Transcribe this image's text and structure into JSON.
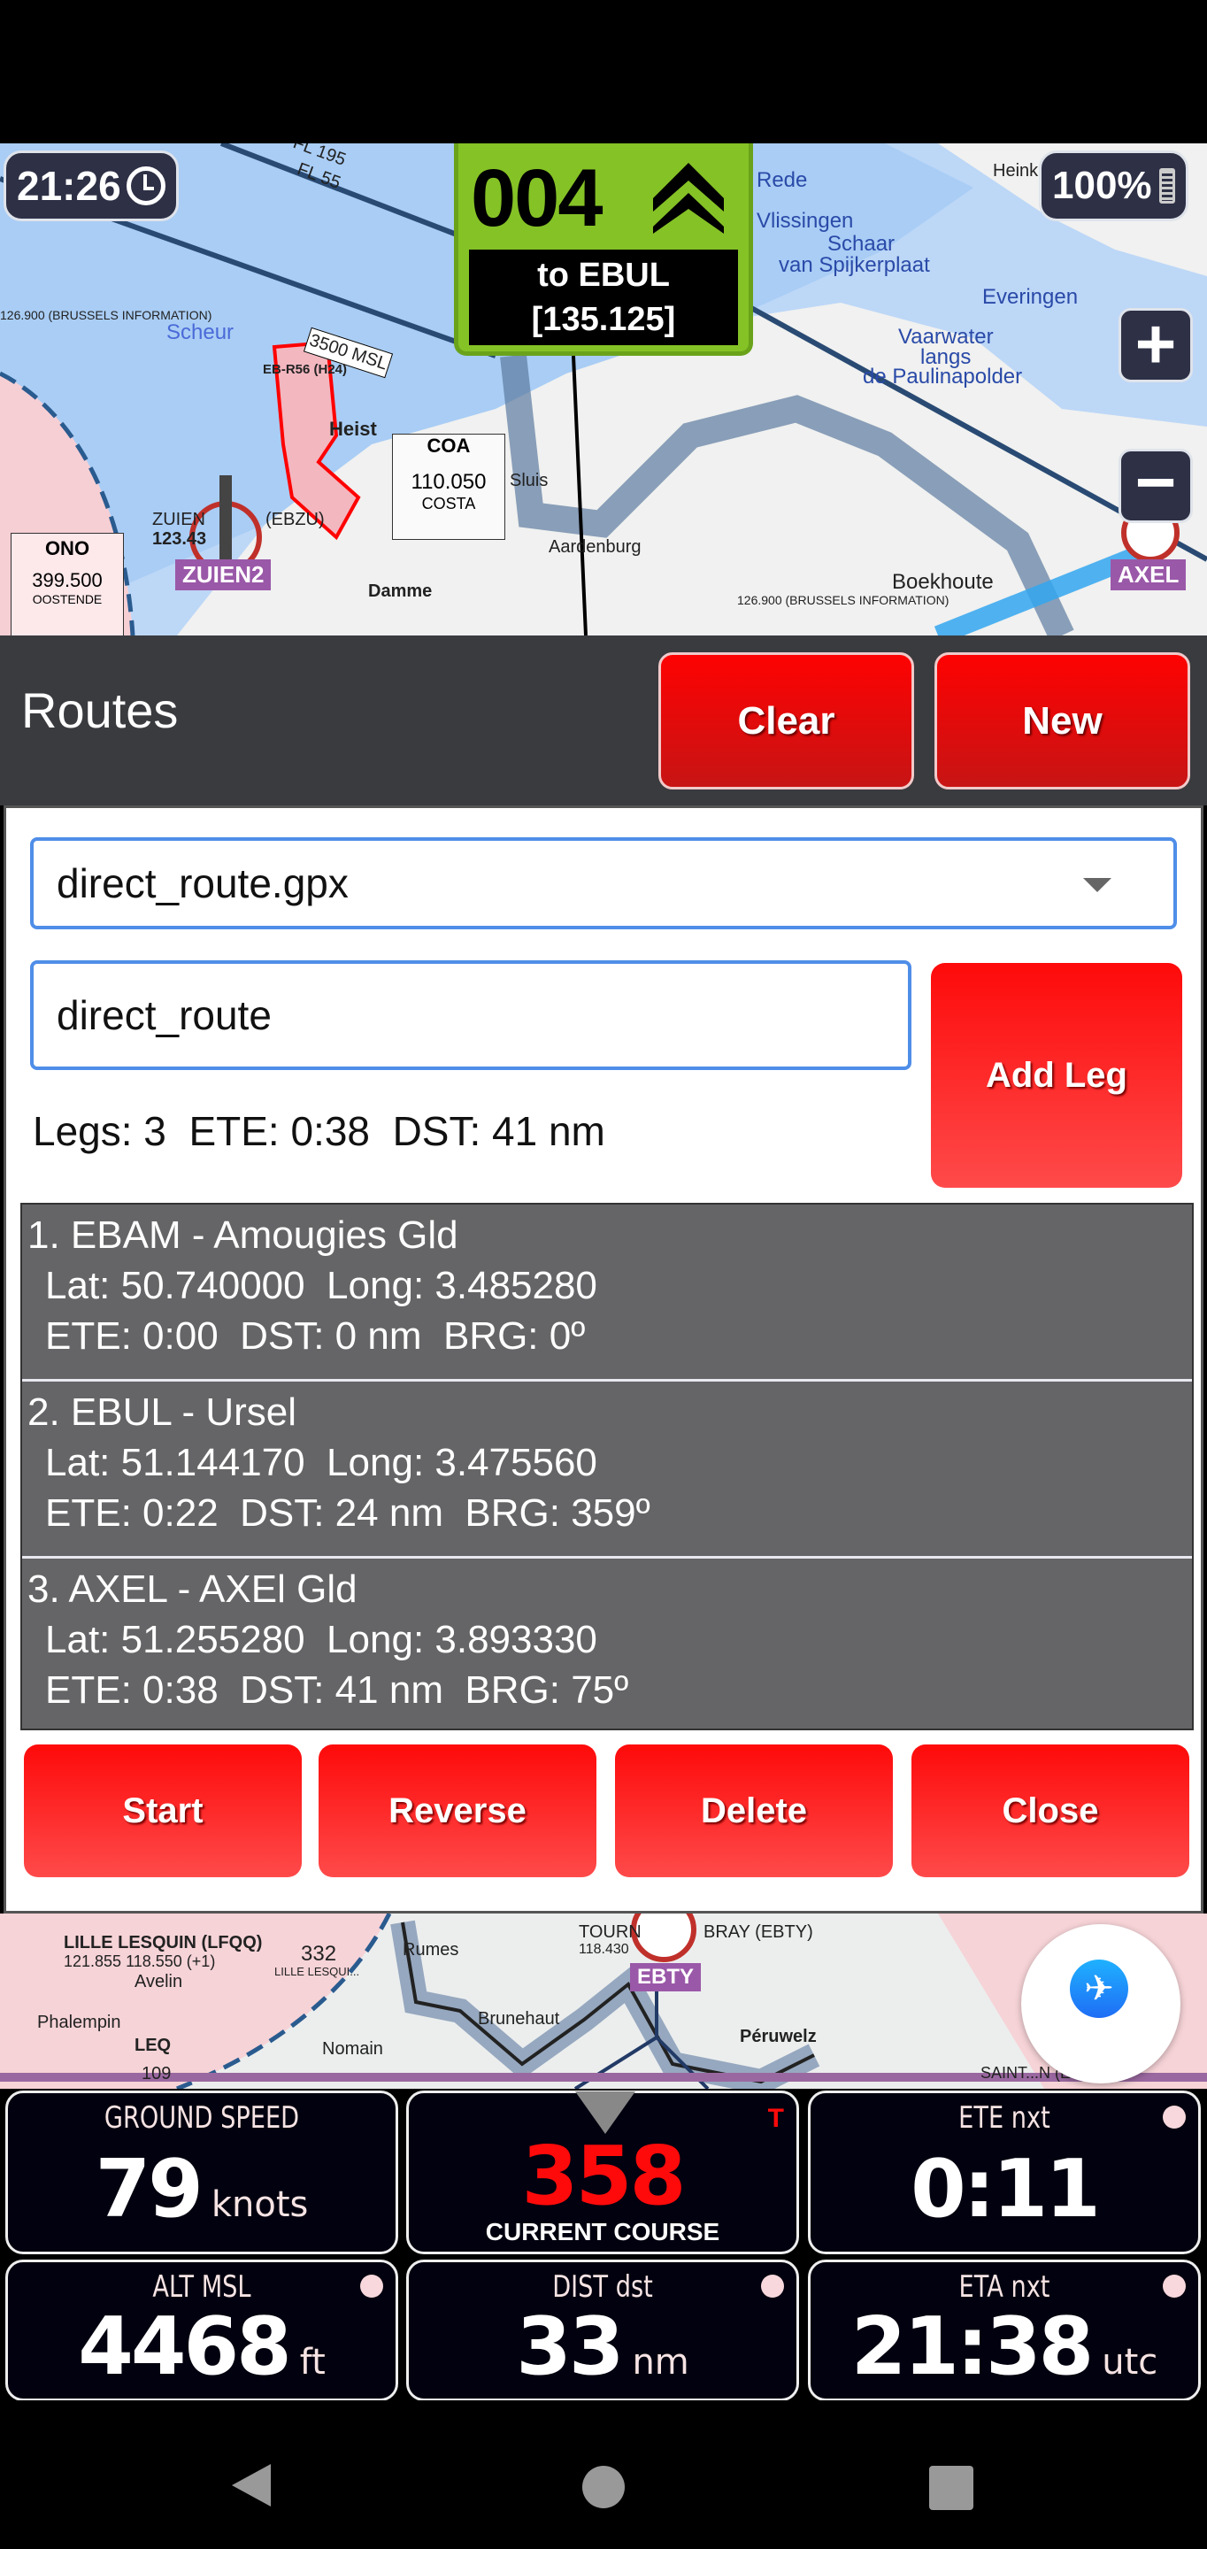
{
  "status": {
    "clock": "21:26",
    "battery": "100%"
  },
  "heading": {
    "value": "004",
    "target": "to EBUL",
    "frequency": "[135.125]",
    "color": "#85c226"
  },
  "map_labels": {
    "top": [
      "FL 195",
      "FL 55",
      "Scheur",
      "3500 MSL",
      "126.900 (BRUSSELS INFORMATION)",
      "EB-R56 (H24)",
      "Heist",
      "COA",
      "110.050",
      "COSTA",
      "Sluis",
      "Aardenburg",
      "Damme",
      "ONO",
      "399.500",
      "OOSTENDE",
      "ZUIEN",
      "123.43",
      "(EBZU)",
      "Rede",
      "Vlissingen",
      "Schaar",
      "van Spijkerplaat",
      "Everingen",
      "Vaarwater",
      "langs",
      "de Paulinapolder",
      "Heinkenszand",
      "Boekhoute",
      "126.900 (BRUSSELS INFORMATION)"
    ],
    "bottom": [
      "LILLE LESQUIN (LFQQ)",
      "121.855 118.550 (+1)",
      "332",
      "LILLE LESQUI...",
      "Avelin",
      "Phalempin",
      "LEQ",
      "109",
      "Nomain",
      "Rumes",
      "TOURN",
      "118.430",
      "BRAY (EBTY)",
      "Brunehaut",
      "Péruwelz",
      "SAINT...N (EBSG)"
    ]
  },
  "waypoint_tags": [
    "ZUIEN2",
    "AXEL",
    "EBTY"
  ],
  "zoom": {
    "in": "+",
    "out": "−"
  },
  "routes": {
    "title": "Routes",
    "clear_label": "Clear",
    "new_label": "New",
    "file_select": "direct_route.gpx",
    "route_name": "direct_route",
    "add_leg_label": "Add Leg",
    "summary": "Legs: 3  ETE: 0:38  DST: 41 nm",
    "legs": [
      {
        "title": "1. EBAM - Amougies Gld",
        "coords": "Lat: 50.740000  Long: 3.485280",
        "stats": "ETE: 0:00  DST: 0 nm  BRG: 0º"
      },
      {
        "title": "2. EBUL - Ursel",
        "coords": "Lat: 51.144170  Long: 3.475560",
        "stats": "ETE: 0:22  DST: 24 nm  BRG: 359º"
      },
      {
        "title": "3. AXEL - AXEl Gld",
        "coords": "Lat: 51.255280  Long: 3.893330",
        "stats": "ETE: 0:38  DST: 41 nm  BRG: 75º"
      }
    ],
    "actions": {
      "start": "Start",
      "reverse": "Reverse",
      "delete": "Delete",
      "close": "Close"
    }
  },
  "instruments": [
    {
      "label": "GROUND SPEED",
      "value": "79",
      "unit": "knots"
    },
    {
      "label": "CURRENT COURSE",
      "value": "358",
      "unit": "",
      "flag": "T",
      "color": "#ff0a0a"
    },
    {
      "label": "ETE nxt",
      "value": "0:11",
      "unit": ""
    },
    {
      "label": "ALT MSL",
      "value": "4468",
      "unit": "ft"
    },
    {
      "label": "DIST dst",
      "value": "33",
      "unit": "nm"
    },
    {
      "label": "ETA nxt",
      "value": "21:38",
      "unit": "utc"
    }
  ],
  "colors": {
    "button_red": "#e00808",
    "header": "#3a3b3f",
    "list_bg": "#656466",
    "input_border": "#4f8ee8"
  }
}
